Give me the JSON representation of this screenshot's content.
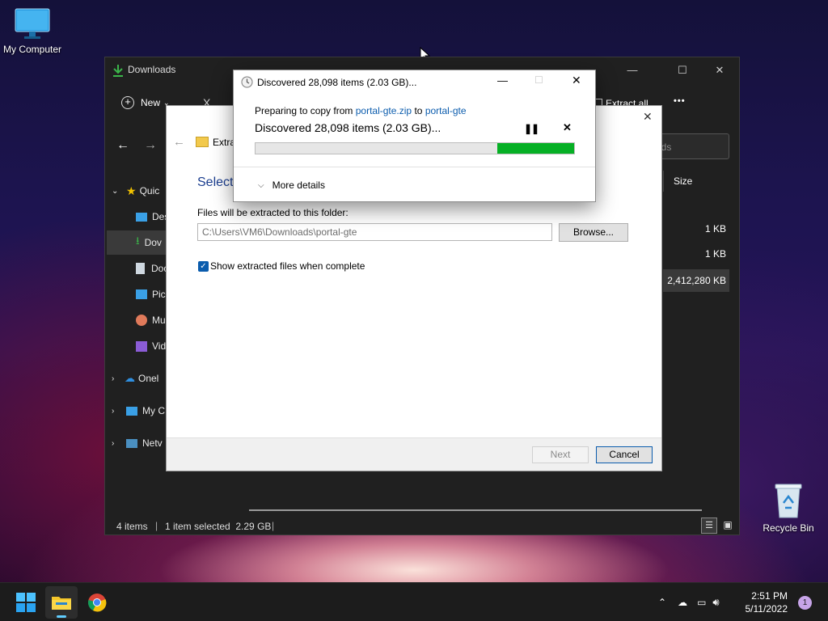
{
  "desktop": {
    "icons": [
      {
        "label": "My Computer",
        "icon": "monitor-icon"
      },
      {
        "label": "Recycle Bin",
        "icon": "recycle-bin-icon"
      }
    ]
  },
  "explorer": {
    "title": "Downloads",
    "toolbar": {
      "new_label": "New",
      "cut_symbol": "X",
      "extract_all_label": "Extract all",
      "more_label": "•••"
    },
    "search_placeholder": "ads",
    "column_size_header": "Size",
    "nav_items": [
      {
        "label": "Quic",
        "icon": "star-icon"
      },
      {
        "label": "Des",
        "icon": "desktop-icon"
      },
      {
        "label": "Dov",
        "icon": "download-icon"
      },
      {
        "label": "Doc",
        "icon": "document-icon"
      },
      {
        "label": "Pic",
        "icon": "pictures-icon"
      },
      {
        "label": "Mu",
        "icon": "music-icon"
      },
      {
        "label": "Vid",
        "icon": "video-icon"
      },
      {
        "label": "Onel",
        "icon": "cloud-icon"
      },
      {
        "label": "My C",
        "icon": "computer-icon"
      },
      {
        "label": "Netv",
        "icon": "network-icon"
      }
    ],
    "file_sizes": [
      "1 KB",
      "1 KB",
      "2,412,280 KB"
    ],
    "status": {
      "item_count": "4 items",
      "selection": "1 item selected  2.29 GB"
    }
  },
  "extract_dialog": {
    "title": "Extra",
    "heading": "Select",
    "folder_label": "Files will be extracted to this folder:",
    "folder_path": "C:\\Users\\VM6\\Downloads\\portal-gte",
    "browse_label": "Browse...",
    "show_files_label": "Show extracted files when complete",
    "show_files_checked": true,
    "next_label": "Next",
    "cancel_label": "Cancel"
  },
  "copy_dialog": {
    "title": "Discovered 28,098 items (2.03 GB)...",
    "preparing_prefix": "Preparing to copy from",
    "source": "portal-gte.zip",
    "to_word": "to",
    "destination": "portal-gte",
    "status": "Discovered 28,098 items (2.03 GB)...",
    "progress_fraction": 0.24,
    "more_details_label": "More details"
  },
  "taskbar": {
    "time": "2:51 PM",
    "date": "5/11/2022",
    "notification_count": "1"
  },
  "colors": {
    "progress_green": "#06b025",
    "accent": "#0078d4"
  }
}
